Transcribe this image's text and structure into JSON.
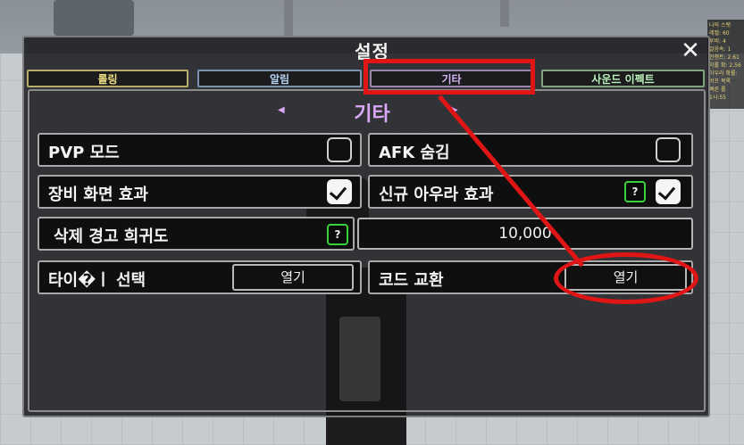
{
  "window": {
    "title": "설정",
    "close_glyph": "✕"
  },
  "tabs": [
    {
      "label": "롤링",
      "color": "#f0e184"
    },
    {
      "label": "알림",
      "color": "#b9d4f3"
    },
    {
      "label": "기타",
      "color": "#d3b3ef",
      "selected": true
    },
    {
      "label": "사운드 이펙트",
      "color": "#b9efb9"
    }
  ],
  "section": {
    "title": "기타",
    "prev_glyph": "◀",
    "next_glyph": "▶"
  },
  "settings": {
    "pvp_mode": {
      "label": "PVP 모드",
      "checked": false
    },
    "afk_hide": {
      "label": "AFK 숨김",
      "checked": false
    },
    "equip_screen_effect": {
      "label": "장비 화면 효과",
      "checked": true
    },
    "new_aura_effect": {
      "label": "신규 아우라 효과",
      "checked": true,
      "help": "?"
    },
    "delete_warning_rarity": {
      "label": "삭제 경고 희귀도",
      "help": "?",
      "value": "10,000"
    },
    "title_select": {
      "label": "타이�ㅣ 선택",
      "button": "열기"
    },
    "code_exchange": {
      "label": "코드 교환",
      "button": "열기"
    }
  },
  "hud": {
    "lines": [
      "나의 스탯",
      "레벨: 60",
      "루비: 4",
      "걸음속: 1",
      "인챈트: 2.61",
      "리롤 확: 2.56",
      "아우라 확률:",
      "버프 목록",
      "빠른 롤",
      "1시:55"
    ]
  },
  "annotations": {
    "color": "#e01515"
  }
}
